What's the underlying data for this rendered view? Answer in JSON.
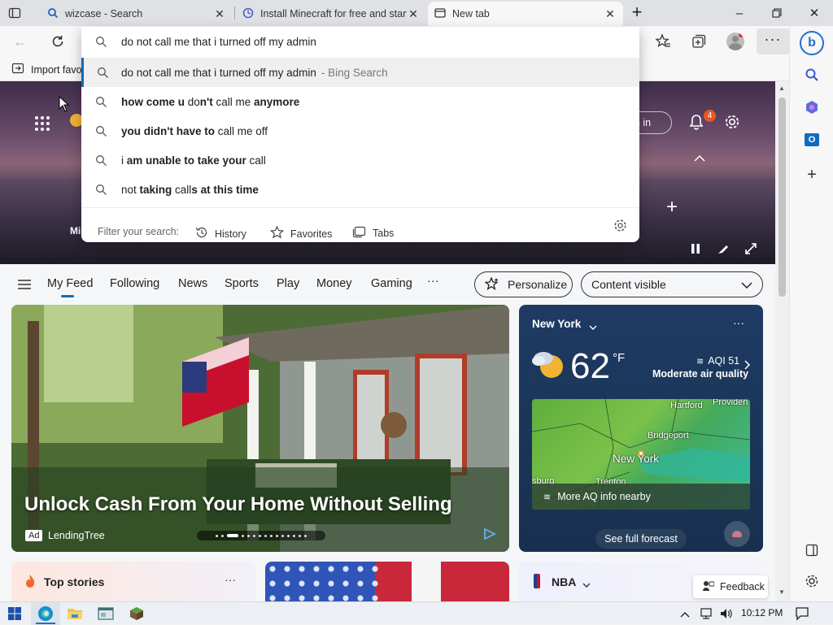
{
  "tabs": [
    {
      "title": "wizcase - Search"
    },
    {
      "title": "Install Minecraft for free and start"
    },
    {
      "title": "New tab"
    }
  ],
  "toolbar": {
    "address_value": "do not call me that i turned off my admin"
  },
  "favorites": {
    "import_label": "Import favo"
  },
  "suggestions": {
    "bing": {
      "query": "do not call me that i turned off my admin",
      "suffix": "- Bing Search"
    },
    "items": [
      [
        {
          "t": "how come u ",
          "b": true
        },
        {
          "t": "do",
          "b": false
        },
        {
          "t": "n't",
          "b": true
        },
        {
          "t": " call me ",
          "b": false
        },
        {
          "t": "anymore",
          "b": true
        }
      ],
      [
        {
          "t": "you didn't have to",
          "b": true
        },
        {
          "t": " call me off",
          "b": false
        }
      ],
      [
        {
          "t": "i ",
          "b": false
        },
        {
          "t": "am unable to take your",
          "b": true
        },
        {
          "t": " call",
          "b": false
        }
      ],
      [
        {
          "t": "not ",
          "b": false
        },
        {
          "t": "taking",
          "b": true
        },
        {
          "t": " call",
          "b": false
        },
        {
          "t": "s at this time",
          "b": true
        }
      ]
    ],
    "filter_label": "Filter your search:",
    "filters": [
      "History",
      "Favorites",
      "Tabs"
    ]
  },
  "hero": {
    "signin_label": "gn in",
    "notif_count": "4",
    "hidden_left_label": "Mi"
  },
  "feed_nav": {
    "items": [
      "My Feed",
      "Following",
      "News",
      "Sports",
      "Play",
      "Money",
      "Gaming"
    ],
    "more": "···",
    "personalize": "Personalize",
    "content_visible": "Content visible"
  },
  "main_card": {
    "headline": "Unlock Cash From Your Home Without Selling",
    "ad_badge": "Ad",
    "advertiser": "LendingTree"
  },
  "weather": {
    "location": "New York",
    "temp": "62",
    "unit": "°F",
    "aqi": "AQI 51",
    "aqi_desc": "Moderate air quality",
    "map_labels": [
      "Hartford",
      "Providen",
      "Bridgeport",
      "New York",
      "sburg",
      "Trenton"
    ],
    "aq_more": "More AQ info nearby",
    "forecast": "See full forecast"
  },
  "bottom": {
    "top_stories": "Top stories",
    "nba": "NBA",
    "feedback": "Feedback"
  },
  "taskbar": {
    "time": "10:12 PM"
  },
  "colors": {
    "accent": "#0f6cbd",
    "notif_badge": "#e35a28"
  }
}
